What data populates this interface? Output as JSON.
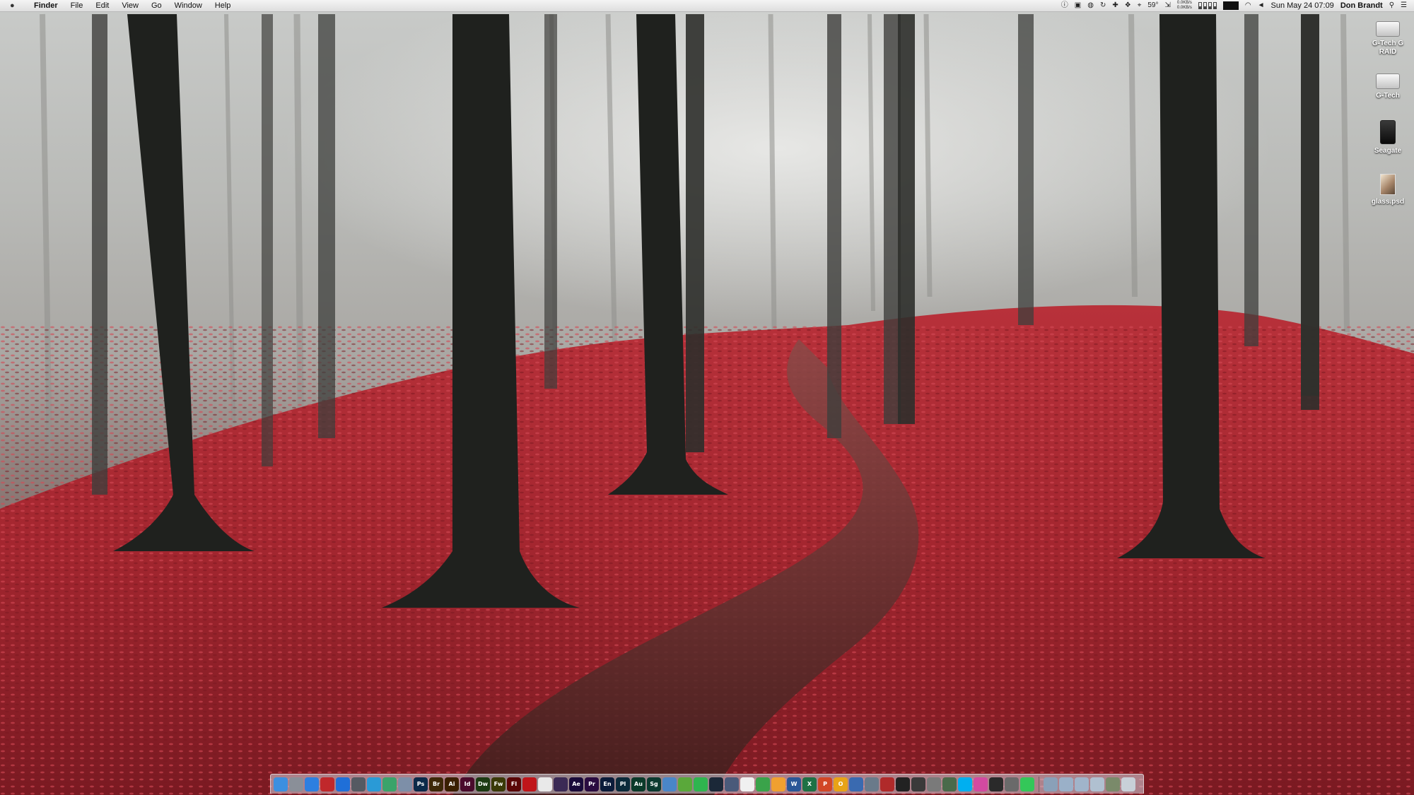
{
  "menubar": {
    "app_name": "Finder",
    "menus": [
      "File",
      "Edit",
      "View",
      "Go",
      "Window",
      "Help"
    ],
    "temperature": "59°",
    "net_up": "0.0KB/s",
    "net_down": "0.0KB/s",
    "clock": "Sun May 24  07:09",
    "user": "Don Brandt"
  },
  "desktop_icons": [
    {
      "label": "G-Tech G RAID",
      "kind": "drive-white"
    },
    {
      "label": "G-Tech",
      "kind": "drive-white"
    },
    {
      "label": "Seagate",
      "kind": "drive-black"
    },
    {
      "label": "glass.psd",
      "kind": "psd-file"
    }
  ],
  "dock": {
    "apps": [
      {
        "name": "finder-icon",
        "label": "",
        "color": "#3c8fe0"
      },
      {
        "name": "system-preferences-icon",
        "label": "",
        "color": "#8a8f98"
      },
      {
        "name": "safari-icon",
        "label": "",
        "color": "#2d7fe0"
      },
      {
        "name": "mail-icon",
        "label": "",
        "color": "#c0282b"
      },
      {
        "name": "app-store-icon",
        "label": "",
        "color": "#1f6fd8"
      },
      {
        "name": "activity-monitor-icon",
        "label": "",
        "color": "#555a62"
      },
      {
        "name": "preview-icon",
        "label": "",
        "color": "#2a9ad6"
      },
      {
        "name": "maps-icon",
        "label": "",
        "color": "#3aa36a"
      },
      {
        "name": "finder-window-icon",
        "label": "",
        "color": "#7d8fa8"
      },
      {
        "name": "photoshop-icon",
        "label": "Ps",
        "color": "#0b2a4a"
      },
      {
        "name": "bridge-icon",
        "label": "Br",
        "color": "#3d2808"
      },
      {
        "name": "illustrator-icon",
        "label": "Ai",
        "color": "#3a1f00"
      },
      {
        "name": "indesign-icon",
        "label": "Id",
        "color": "#4a0b2c"
      },
      {
        "name": "dreamweaver-icon",
        "label": "Dw",
        "color": "#1c3a12"
      },
      {
        "name": "fireworks-icon",
        "label": "Fw",
        "color": "#3a3a08"
      },
      {
        "name": "flash-icon",
        "label": "Fl",
        "color": "#5a0606"
      },
      {
        "name": "acrobat-icon",
        "label": "",
        "color": "#c0151a"
      },
      {
        "name": "acrobat-reader-icon",
        "label": "",
        "color": "#e9e9e9"
      },
      {
        "name": "media-encoder-icon",
        "label": "",
        "color": "#3b2a55"
      },
      {
        "name": "after-effects-icon",
        "label": "Ae",
        "color": "#1a0b3a"
      },
      {
        "name": "premiere-icon",
        "label": "Pr",
        "color": "#2a0b40"
      },
      {
        "name": "encore-icon",
        "label": "En",
        "color": "#0b1c3a"
      },
      {
        "name": "prelude-icon",
        "label": "Pl",
        "color": "#0b2a3a"
      },
      {
        "name": "audition-icon",
        "label": "Au",
        "color": "#0b3a2a"
      },
      {
        "name": "speedgrade-icon",
        "label": "Sg",
        "color": "#0b3a30"
      },
      {
        "name": "keynote-icon",
        "label": "",
        "color": "#4a86c8"
      },
      {
        "name": "leaf-app-icon",
        "label": "",
        "color": "#5aa83a"
      },
      {
        "name": "evernote-icon",
        "label": "",
        "color": "#2fb54f"
      },
      {
        "name": "steam-icon",
        "label": "",
        "color": "#1b2838"
      },
      {
        "name": "network-utility-icon",
        "label": "",
        "color": "#4a5a7a"
      },
      {
        "name": "text-edit-icon",
        "label": "",
        "color": "#f0f0f0"
      },
      {
        "name": "numbers-icon",
        "label": "",
        "color": "#3aa34a"
      },
      {
        "name": "pages-icon",
        "label": "",
        "color": "#f0a030"
      },
      {
        "name": "word-icon",
        "label": "W",
        "color": "#2b5797"
      },
      {
        "name": "excel-icon",
        "label": "X",
        "color": "#1e7145"
      },
      {
        "name": "powerpoint-icon",
        "label": "P",
        "color": "#d24726"
      },
      {
        "name": "outlook-icon",
        "label": "O",
        "color": "#e8a317"
      },
      {
        "name": "vpn-icon",
        "label": "",
        "color": "#3a6ab0"
      },
      {
        "name": "image-capture-icon",
        "label": "",
        "color": "#6a7a8a"
      },
      {
        "name": "photo-booth-icon",
        "label": "",
        "color": "#b02a2a"
      },
      {
        "name": "terminal-icon",
        "label": "",
        "color": "#222222"
      },
      {
        "name": "calculator-icon",
        "label": "",
        "color": "#3a3a3a"
      },
      {
        "name": "disk-utility-icon",
        "label": "",
        "color": "#7a7a7a"
      },
      {
        "name": "chess-icon",
        "label": "",
        "color": "#4a6a4a"
      },
      {
        "name": "skype-icon",
        "label": "",
        "color": "#00aff0"
      },
      {
        "name": "itunes-icon",
        "label": "",
        "color": "#d34aa0"
      },
      {
        "name": "dvd-player-icon",
        "label": "",
        "color": "#2a2a2a"
      },
      {
        "name": "font-book-icon",
        "label": "",
        "color": "#6a6a6a"
      },
      {
        "name": "messages-icon",
        "label": "",
        "color": "#34c759"
      }
    ],
    "stack_items": [
      {
        "name": "applications-stack-icon",
        "color": "#8aa0b8"
      },
      {
        "name": "documents-stack-icon",
        "color": "#9ab0c8"
      },
      {
        "name": "downloads-stack-icon",
        "color": "#a0b4ca"
      },
      {
        "name": "screenshot-stack-icon",
        "color": "#b0c0d0"
      },
      {
        "name": "photo-stack-icon",
        "color": "#7a8a6a"
      },
      {
        "name": "trash-icon",
        "color": "#c8d0d8"
      }
    ]
  }
}
